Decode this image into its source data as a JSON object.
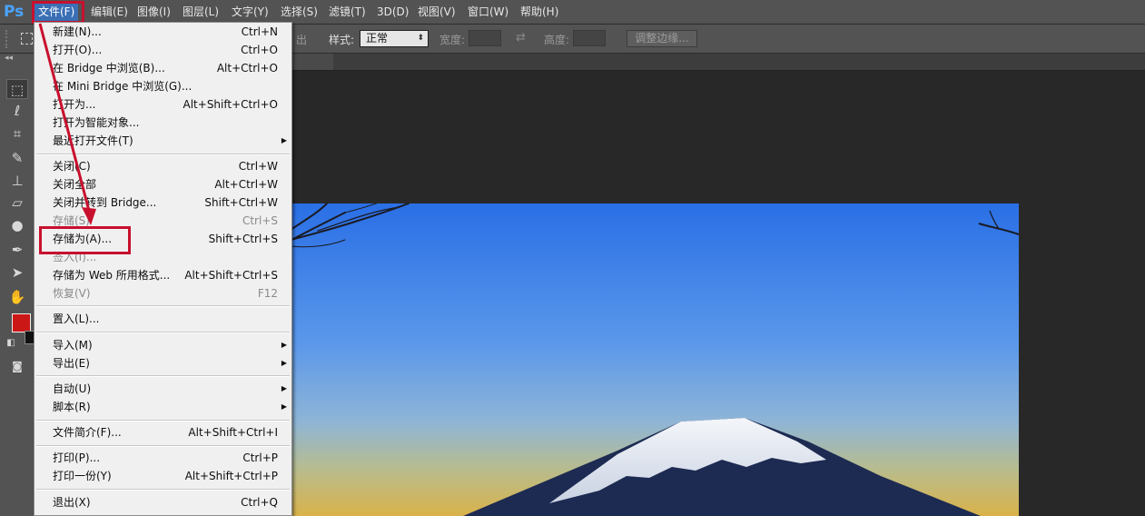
{
  "app": {
    "logo": "Ps"
  },
  "menubar": {
    "items": [
      {
        "label": "文件(F)",
        "active": true
      },
      {
        "label": "编辑(E)"
      },
      {
        "label": "图像(I)"
      },
      {
        "label": "图层(L)"
      },
      {
        "label": "文字(Y)"
      },
      {
        "label": "选择(S)"
      },
      {
        "label": "滤镜(T)"
      },
      {
        "label": "3D(D)"
      },
      {
        "label": "视图(V)"
      },
      {
        "label": "窗口(W)"
      },
      {
        "label": "帮助(H)"
      }
    ]
  },
  "options": {
    "partial_label": "出",
    "style_label": "样式:",
    "style_value": "正常",
    "width_label": "宽度:",
    "height_label": "高度:",
    "refine_edge_label": "调整边缘..."
  },
  "file_menu": {
    "items": [
      {
        "label": "新建(N)...",
        "shortcut": "Ctrl+N"
      },
      {
        "label": "打开(O)...",
        "shortcut": "Ctrl+O"
      },
      {
        "label": "在 Bridge 中浏览(B)...",
        "shortcut": "Alt+Ctrl+O"
      },
      {
        "label": "在 Mini Bridge 中浏览(G)...",
        "shortcut": ""
      },
      {
        "label": "打开为...",
        "shortcut": "Alt+Shift+Ctrl+O"
      },
      {
        "label": "打开为智能对象...",
        "shortcut": ""
      },
      {
        "label": "最近打开文件(T)",
        "shortcut": "",
        "submenu": true
      },
      {
        "label": "关闭(C)",
        "shortcut": "Ctrl+W"
      },
      {
        "label": "关闭全部",
        "shortcut": "Alt+Ctrl+W"
      },
      {
        "label": "关闭并转到 Bridge...",
        "shortcut": "Shift+Ctrl+W"
      },
      {
        "label": "存储(S)",
        "shortcut": "Ctrl+S",
        "disabled": true
      },
      {
        "label": "存储为(A)...",
        "shortcut": "Shift+Ctrl+S",
        "highlighted": true
      },
      {
        "label": "签入(I)...",
        "shortcut": "",
        "disabled": true
      },
      {
        "label": "存储为 Web 所用格式...",
        "shortcut": "Alt+Shift+Ctrl+S"
      },
      {
        "label": "恢复(V)",
        "shortcut": "F12",
        "disabled": true
      },
      {
        "label": "置入(L)...",
        "shortcut": ""
      },
      {
        "label": "导入(M)",
        "shortcut": "",
        "submenu": true
      },
      {
        "label": "导出(E)",
        "shortcut": "",
        "submenu": true
      },
      {
        "label": "自动(U)",
        "shortcut": "",
        "submenu": true
      },
      {
        "label": "脚本(R)",
        "shortcut": "",
        "submenu": true
      },
      {
        "label": "文件简介(F)...",
        "shortcut": "Alt+Shift+Ctrl+I"
      },
      {
        "label": "打印(P)...",
        "shortcut": "Ctrl+P"
      },
      {
        "label": "打印一份(Y)",
        "shortcut": "Alt+Shift+Ctrl+P"
      },
      {
        "label": "退出(X)",
        "shortcut": "Ctrl+Q"
      }
    ]
  },
  "colors": {
    "foreground": "#cc1717",
    "background": "#111111",
    "annotation": "#c8102e",
    "menu_active": "#3a6fb5"
  },
  "tools": [
    "rectangular-marquee-icon",
    "lasso-icon",
    "crop-icon",
    "spot-healing-brush-icon",
    "clone-stamp-icon",
    "eraser-icon",
    "blur-icon",
    "pen-icon",
    "path-selection-icon",
    "hand-icon",
    "quick-mask-icon"
  ]
}
